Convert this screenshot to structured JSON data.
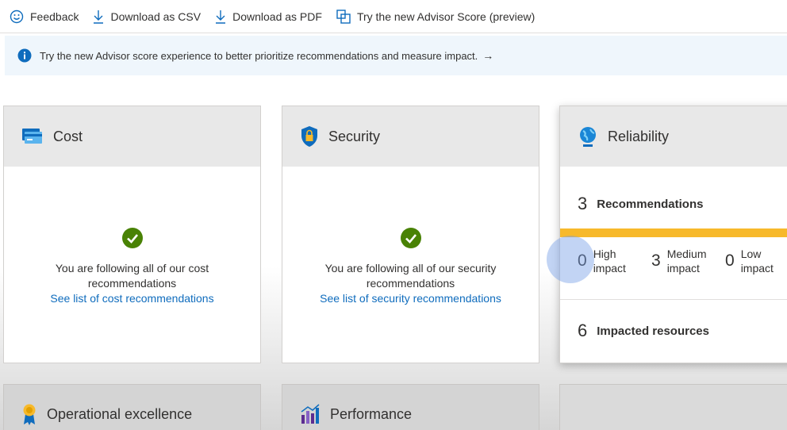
{
  "toolbar": {
    "feedback": "Feedback",
    "download_csv": "Download as CSV",
    "download_pdf": "Download as PDF",
    "try_advisor": "Try the new Advisor Score (preview)"
  },
  "banner": {
    "text": "Try the new Advisor score experience to better prioritize recommendations and measure impact.",
    "arrow": "→"
  },
  "cards": {
    "cost": {
      "title": "Cost",
      "message": "You are following all of our cost recommendations",
      "link": "See list of cost recommendations"
    },
    "security": {
      "title": "Security",
      "message": "You are following all of our security recommendations",
      "link": "See list of security recommendations"
    },
    "reliability": {
      "title": "Reliability",
      "recommendations_count": "3",
      "recommendations_label": "Recommendations",
      "high_count": "0",
      "high_label_1": "High",
      "high_label_2": "impact",
      "medium_count": "3",
      "medium_label_1": "Medium",
      "medium_label_2": "impact",
      "low_count": "0",
      "low_label_1": "Low",
      "low_label_2": "impact",
      "impacted_count": "6",
      "impacted_label": "Impacted resources"
    },
    "operational": {
      "title": "Operational excellence"
    },
    "performance": {
      "title": "Performance"
    }
  },
  "colors": {
    "accent": "#0f6cbd",
    "check_green": "#498205",
    "bar_yellow": "#f7b92b"
  }
}
